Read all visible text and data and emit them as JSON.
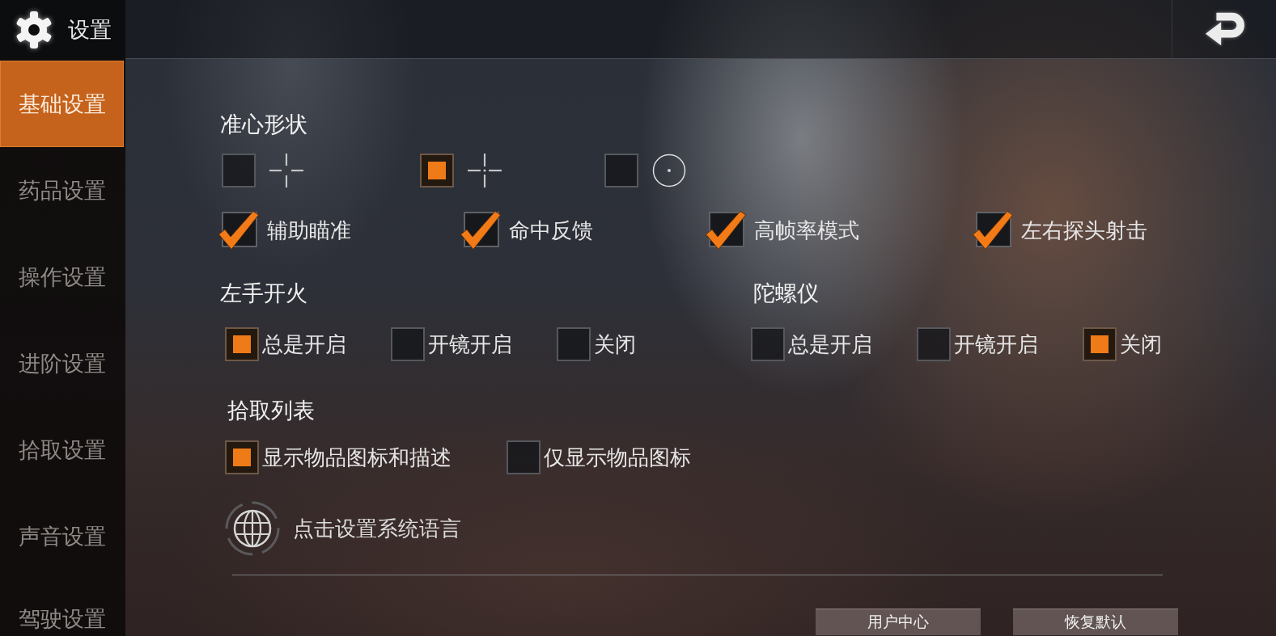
{
  "header": {
    "title": "设置"
  },
  "sidebar": {
    "items": [
      {
        "label": "基础设置",
        "selected": true
      },
      {
        "label": "药品设置",
        "selected": false
      },
      {
        "label": "操作设置",
        "selected": false
      },
      {
        "label": "进阶设置",
        "selected": false
      },
      {
        "label": "拾取设置",
        "selected": false
      },
      {
        "label": "声音设置",
        "selected": false
      },
      {
        "label": "驾驶设置",
        "selected": false
      }
    ]
  },
  "crosshair_shape": {
    "title": "准心形状",
    "options": [
      {
        "kind": "cross",
        "selected": false
      },
      {
        "kind": "dotcross",
        "selected": true
      },
      {
        "kind": "circle",
        "selected": false
      }
    ]
  },
  "toggles": [
    {
      "label": "辅助瞄准",
      "checked": true
    },
    {
      "label": "命中反馈",
      "checked": true
    },
    {
      "label": "高帧率模式",
      "checked": true
    },
    {
      "label": "左右探头射击",
      "checked": true
    }
  ],
  "left_hand_fire": {
    "title": "左手开火",
    "options": [
      {
        "label": "总是开启",
        "selected": true
      },
      {
        "label": "开镜开启",
        "selected": false
      },
      {
        "label": "关闭",
        "selected": false
      }
    ]
  },
  "gyroscope": {
    "title": "陀螺仪",
    "options": [
      {
        "label": "总是开启",
        "selected": false
      },
      {
        "label": "开镜开启",
        "selected": false
      },
      {
        "label": "关闭",
        "selected": true
      }
    ]
  },
  "pickup_list": {
    "title": "拾取列表",
    "options": [
      {
        "label": "显示物品图标和描述",
        "selected": true
      },
      {
        "label": "仅显示物品图标",
        "selected": false
      }
    ]
  },
  "language": {
    "label": "点击设置系统语言"
  },
  "buttons": [
    "用户中心",
    "恢复默认"
  ]
}
